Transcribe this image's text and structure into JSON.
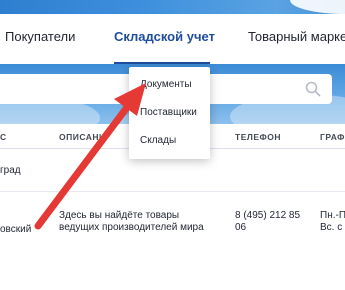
{
  "nav": {
    "tabs": [
      {
        "label": "Покупатели"
      },
      {
        "label": "Складской учет"
      },
      {
        "label": "Товарный марке"
      }
    ]
  },
  "table": {
    "headers": [
      "С",
      "ОПИСАНИ",
      "ТЕЛЕФОН",
      "ГРАФ"
    ],
    "rows": [
      {
        "city": "град",
        "description": "",
        "phone": "",
        "schedule": ""
      },
      {
        "city": "овский",
        "description": "Здесь вы найдёте товары ведущих производителей мира",
        "phone": "8 (495) 212 85 06",
        "schedule": "Пн.-П Вс. с"
      }
    ]
  },
  "dropdown": {
    "items": [
      {
        "label": "Документы"
      },
      {
        "label": "Поставщики"
      },
      {
        "label": "Склады"
      }
    ]
  },
  "colors": {
    "accent": "#1f4e9c",
    "arrow": "#e53935",
    "band": "#4a96dc"
  },
  "icons": {
    "search": "search-icon"
  }
}
